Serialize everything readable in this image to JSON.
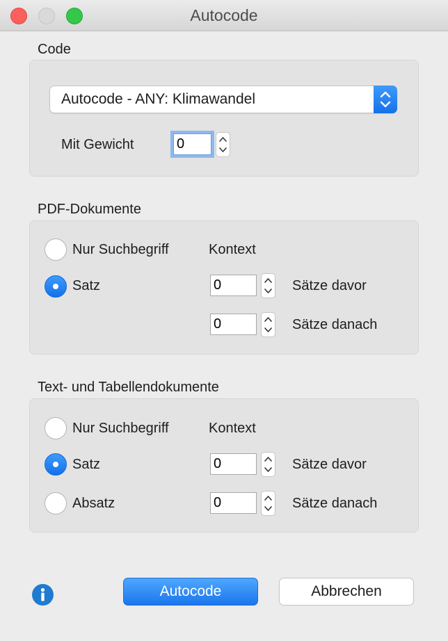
{
  "window": {
    "title": "Autocode"
  },
  "code_section": {
    "title": "Code",
    "code_select_value": "Autocode - ANY: Klimawandel",
    "weight_label": "Mit Gewicht",
    "weight_value": "0"
  },
  "pdf_section": {
    "title": "PDF-Dokumente",
    "radio_search_term": "Nur Suchbegriff",
    "radio_sentence": "Satz",
    "selected": "Satz",
    "context_label": "Kontext",
    "before_value": "0",
    "before_label": "Sätze davor",
    "after_value": "0",
    "after_label": "Sätze danach"
  },
  "text_section": {
    "title": "Text- und Tabellendokumente",
    "radio_search_term": "Nur Suchbegriff",
    "radio_sentence": "Satz",
    "radio_paragraph": "Absatz",
    "selected": "Satz",
    "context_label": "Kontext",
    "before_value": "0",
    "before_label": "Sätze davor",
    "after_value": "0",
    "after_label": "Sätze danach"
  },
  "footer": {
    "info_icon": "info-icon",
    "autocode_button": "Autocode",
    "cancel_button": "Abbrechen"
  },
  "colors": {
    "accent": "#1a76ee",
    "close": "#fc605c",
    "maximize": "#34c84a",
    "info": "#1f7bd0"
  }
}
